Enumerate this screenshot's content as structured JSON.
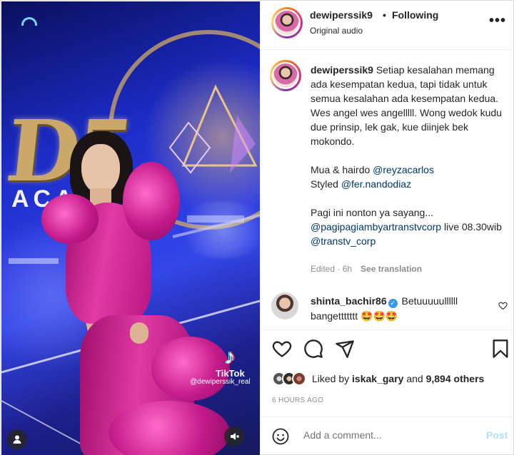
{
  "post": {
    "username": "dewiperssik9",
    "separator": "•",
    "follow_label": "Following",
    "audio": "Original audio",
    "more_label": "•••"
  },
  "media": {
    "logo_text": "D5",
    "logo_subtext": "ACA",
    "watermark_brand": "TikTok",
    "watermark_handle": "@dewiperssik_real"
  },
  "caption": {
    "username": "dewiperssik9",
    "line1": "Setiap kesalahan memang ada kesempatan kedua, tapi tidak untuk semua kesalahan ada kesempatan kedua. Wes angel wes angelllll. Wong wedok kudu due prinsip, lek gak, kue diinjek bek mokondo.",
    "credit_mua_prefix": "Mua & hairdo",
    "credit_mua_handle": "@reyzacarlos",
    "credit_styled_prefix": "Styled",
    "credit_styled_handle": "@fer.nandodiaz",
    "promo_text": "Pagi ini nonton ya sayang...",
    "promo_handle1": "@pagipagiambyartranstvcorp",
    "promo_mid": "live 08.30wib",
    "promo_handle2": "@transtv_corp",
    "edited": "Edited · 6h",
    "see_translation": "See translation"
  },
  "comment": {
    "username": "shinta_bachir86",
    "verified_mark": "✓",
    "text": "Betuuuuullllll bangettttttt 🤩🤩🤩"
  },
  "likes": {
    "prefix": "Liked by",
    "user": "iskak_gary",
    "middle": "and",
    "count": "9,894 others"
  },
  "time_ago": "6 HOURS AGO",
  "add_comment": {
    "placeholder": "Add a comment...",
    "post_label": "Post"
  },
  "colors": {
    "link": "#00376b",
    "muted": "#8e8e8e",
    "post_disabled": "#b2dffc",
    "verified": "#3897f0"
  },
  "icons": [
    "heart-icon",
    "comment-icon",
    "share-icon",
    "bookmark-icon",
    "emoji-icon",
    "user-icon",
    "mute-icon",
    "more-icon",
    "tiktok-icon"
  ]
}
